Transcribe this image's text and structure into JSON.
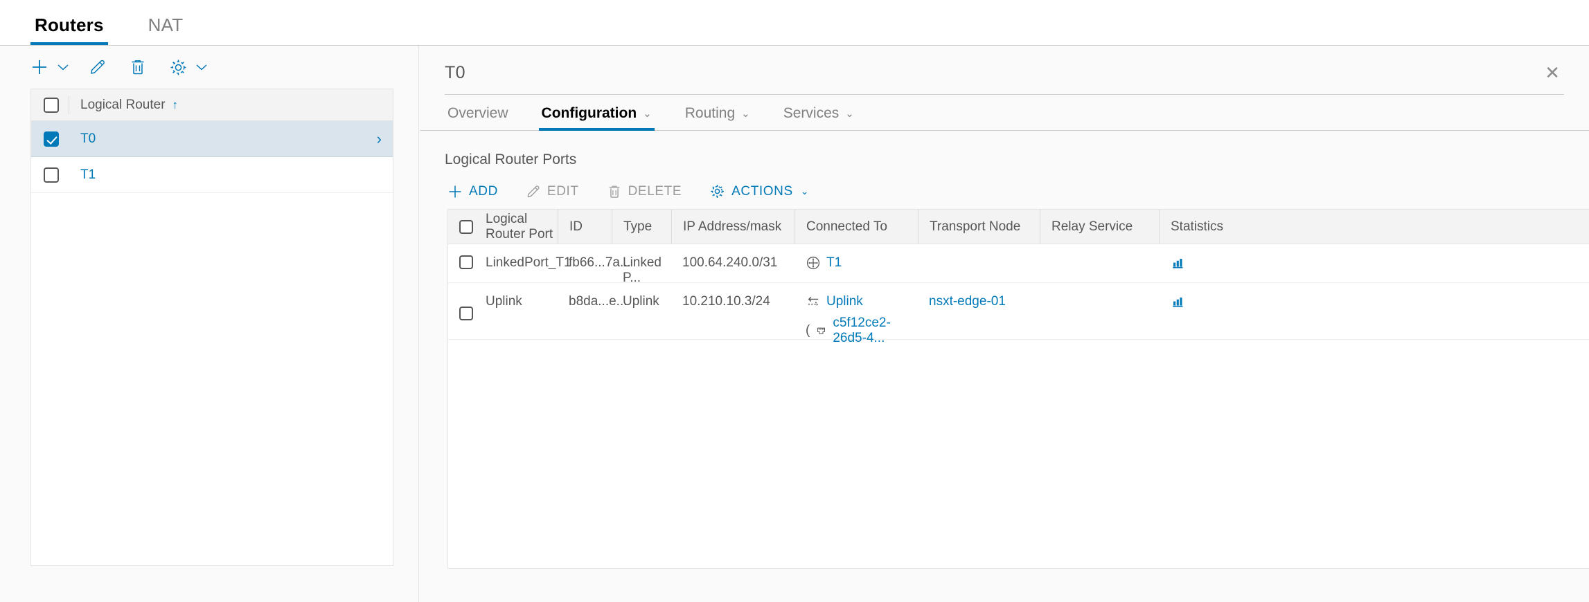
{
  "topbar": {
    "tabs": [
      {
        "label": "Routers",
        "active": true
      },
      {
        "label": "NAT",
        "active": false
      }
    ]
  },
  "left_panel": {
    "toolbar": {
      "add_icon": "plus-icon",
      "add_caret": "chevron-down-icon",
      "edit_icon": "pencil-icon",
      "delete_icon": "trash-icon",
      "settings_icon": "gear-icon",
      "settings_caret": "chevron-down-icon"
    },
    "table": {
      "header": {
        "column": "Logical Router",
        "sort": "↑"
      },
      "rows": [
        {
          "name": "T0",
          "checked": true,
          "selected": true,
          "chevron": "›"
        },
        {
          "name": "T1",
          "checked": false,
          "selected": false,
          "chevron": ""
        }
      ]
    }
  },
  "right_panel": {
    "title": "T0",
    "close_icon": "close-icon",
    "tabs": [
      {
        "label": "Overview",
        "active": false,
        "caret": ""
      },
      {
        "label": "Configuration",
        "active": true,
        "caret": "⌄"
      },
      {
        "label": "Routing",
        "active": false,
        "caret": "⌄"
      },
      {
        "label": "Services",
        "active": false,
        "caret": "⌄"
      }
    ],
    "section_title": "Logical Router Ports",
    "toolbar": [
      {
        "label": "ADD",
        "icon": "plus-icon",
        "disabled": false,
        "caret": ""
      },
      {
        "label": "EDIT",
        "icon": "pencil-icon",
        "disabled": true,
        "caret": ""
      },
      {
        "label": "DELETE",
        "icon": "trash-icon",
        "disabled": true,
        "caret": ""
      },
      {
        "label": "ACTIONS",
        "icon": "gear-icon",
        "disabled": false,
        "caret": "⌄"
      }
    ],
    "table": {
      "columns": [
        "Logical Router Port",
        "ID",
        "Type",
        "IP Address/mask",
        "Connected To",
        "Transport Node",
        "Relay Service",
        "Statistics"
      ],
      "rows": [
        {
          "checked": false,
          "port": "LinkedPort_T1",
          "id": "fb66...7a...",
          "type": "Linked P...",
          "ip": "100.64.240.0/31",
          "connected_to": "T1",
          "connected_icon": "router-icon",
          "connected_secondary": "",
          "connected_secondary_prefix": "",
          "transport_node": "",
          "relay_service": "",
          "statistics_icon": "bar-chart-icon"
        },
        {
          "checked": false,
          "port": "Uplink",
          "id": "b8da...e...",
          "type": "Uplink",
          "ip": "10.210.10.3/24",
          "connected_to": "Uplink",
          "connected_icon": "switch-arrows-icon",
          "connected_secondary": "c5f12ce2-26d5-4...",
          "connected_secondary_prefix": "(",
          "transport_node": "nsxt-edge-01",
          "relay_service": "",
          "statistics_icon": "bar-chart-icon"
        }
      ]
    }
  },
  "colors": {
    "accent": "#0079b8",
    "text": "#565656",
    "muted": "#808080",
    "selected_row_bg": "#d9e4ec",
    "header_bg": "#f3f3f3",
    "page_bg": "#fafafa"
  }
}
